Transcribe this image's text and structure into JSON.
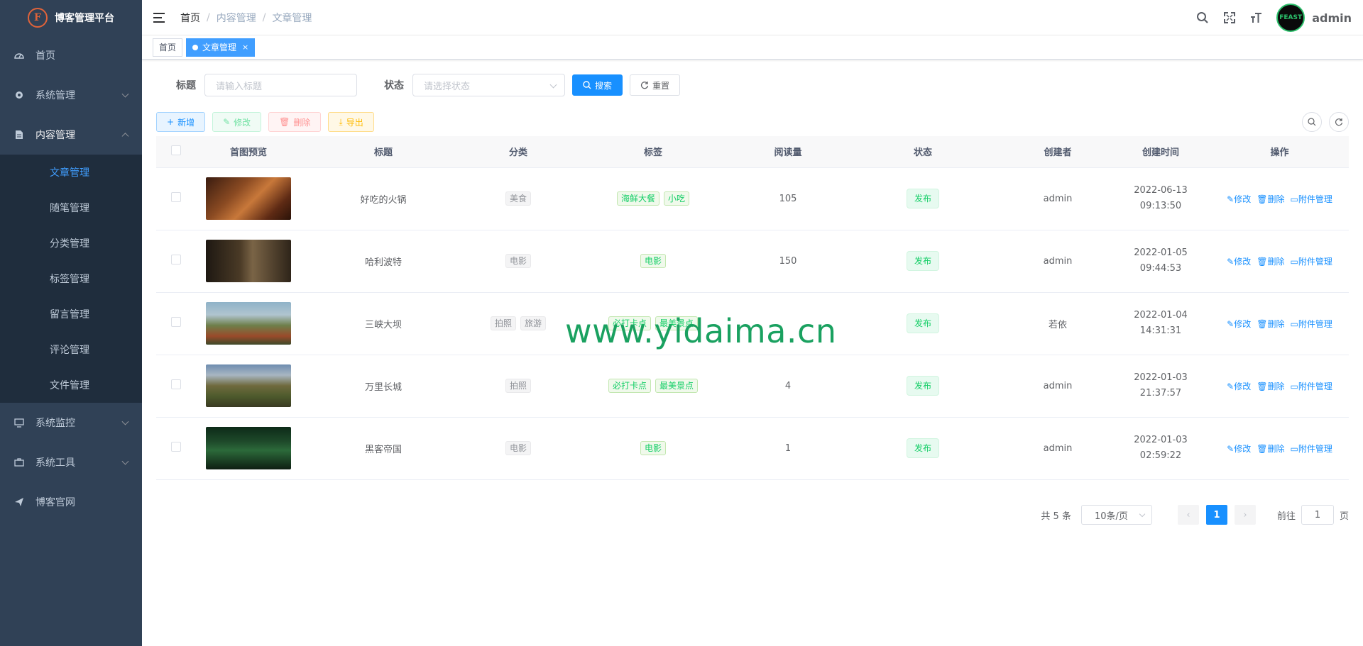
{
  "app": {
    "logo_letter": "F",
    "title": "博客管理平台"
  },
  "sidebar": {
    "items": [
      {
        "label": "首页",
        "icon": "dashboard-icon",
        "has_children": false
      },
      {
        "label": "系统管理",
        "icon": "gear-icon",
        "has_children": true
      },
      {
        "label": "内容管理",
        "icon": "document-icon",
        "has_children": true,
        "open": true,
        "children": [
          "文章管理",
          "随笔管理",
          "分类管理",
          "标签管理",
          "留言管理",
          "评论管理",
          "文件管理"
        ],
        "active_child": "文章管理"
      },
      {
        "label": "系统监控",
        "icon": "monitor-icon",
        "has_children": true
      },
      {
        "label": "系统工具",
        "icon": "toolbox-icon",
        "has_children": true
      },
      {
        "label": "博客官网",
        "icon": "send-icon",
        "has_children": false
      }
    ]
  },
  "breadcrumb": [
    "首页",
    "内容管理",
    "文章管理"
  ],
  "navbar": {
    "username": "admin",
    "avatar_text": "FEAST"
  },
  "tags_view": [
    {
      "label": "首页",
      "active": false
    },
    {
      "label": "文章管理",
      "active": true,
      "close": "×"
    }
  ],
  "search": {
    "title_label": "标题",
    "title_placeholder": "请输入标题",
    "status_label": "状态",
    "status_placeholder": "请选择状态",
    "search_button": "搜索",
    "reset_button": "重置"
  },
  "toolbar": {
    "add": "新增",
    "edit": "修改",
    "delete": "删除",
    "export": "导出"
  },
  "table": {
    "columns": [
      "首图预览",
      "标题",
      "分类",
      "标签",
      "阅读量",
      "状态",
      "创建者",
      "创建时间",
      "操作"
    ],
    "rows": [
      {
        "title": "好吃的火锅",
        "categories": [
          "美食"
        ],
        "tags": [
          "海鲜大餐",
          "小吃"
        ],
        "views": "105",
        "status": "发布",
        "creator": "admin",
        "date": "2022-06-13",
        "time": "09:13:50",
        "thumb": "hotpot"
      },
      {
        "title": "哈利波特",
        "categories": [
          "电影"
        ],
        "tags": [
          "电影"
        ],
        "views": "150",
        "status": "发布",
        "creator": "admin",
        "date": "2022-01-05",
        "time": "09:44:53",
        "thumb": "harry"
      },
      {
        "title": "三峡大坝",
        "categories": [
          "拍照",
          "旅游"
        ],
        "tags": [
          "必打卡点",
          "最美景点"
        ],
        "views": "",
        "status": "发布",
        "creator": "若依",
        "date": "2022-01-04",
        "time": "14:31:31",
        "thumb": "gorge"
      },
      {
        "title": "万里长城",
        "categories": [
          "拍照"
        ],
        "tags": [
          "必打卡点",
          "最美景点"
        ],
        "views": "4",
        "status": "发布",
        "creator": "admin",
        "date": "2022-01-03",
        "time": "21:37:57",
        "thumb": "wall"
      },
      {
        "title": "黑客帝国",
        "categories": [
          "电影"
        ],
        "tags": [
          "电影"
        ],
        "views": "1",
        "status": "发布",
        "creator": "admin",
        "date": "2022-01-03",
        "time": "02:59:22",
        "thumb": "matrix"
      }
    ],
    "ops": {
      "edit": "修改",
      "delete": "删除",
      "attach": "附件管理"
    }
  },
  "pagination": {
    "total_text": "共 5 条",
    "page_size": "10条/页",
    "current": "1",
    "goto_label": "前往",
    "goto_value": "1",
    "page_suffix": "页"
  },
  "watermark": "www.yidaima.cn",
  "colors": {
    "sidebar_bg": "#304156",
    "submenu_bg": "#1f2d3d",
    "primary": "#1890ff",
    "success": "#13ce66"
  }
}
